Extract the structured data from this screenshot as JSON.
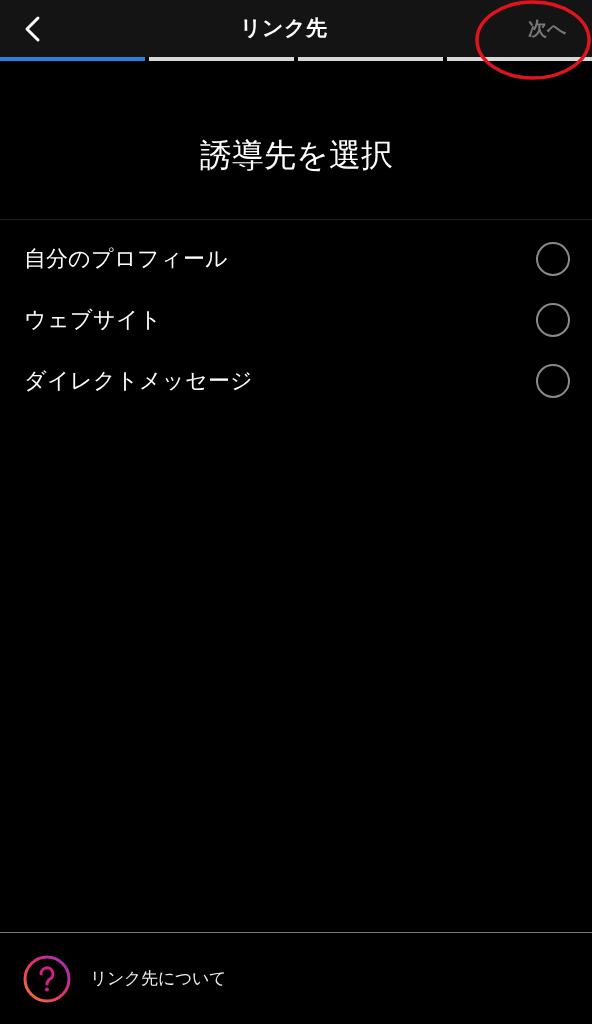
{
  "header": {
    "title": "リンク先",
    "next_button": {
      "label": "次へ",
      "disabled": true
    }
  },
  "steps": [
    {
      "active": true
    },
    {
      "active": false
    },
    {
      "active": false
    },
    {
      "active": false
    }
  ],
  "heading": "誘導先を選択",
  "options": [
    {
      "label": "自分のプロフィール",
      "selected": false
    },
    {
      "label": "ウェブサイト",
      "selected": false
    },
    {
      "label": "ダイレクトメッセージ",
      "selected": false
    }
  ],
  "footer": {
    "label": "リンク先について"
  },
  "annotation": {
    "kind": "ellipse",
    "color": "#e0141e"
  }
}
